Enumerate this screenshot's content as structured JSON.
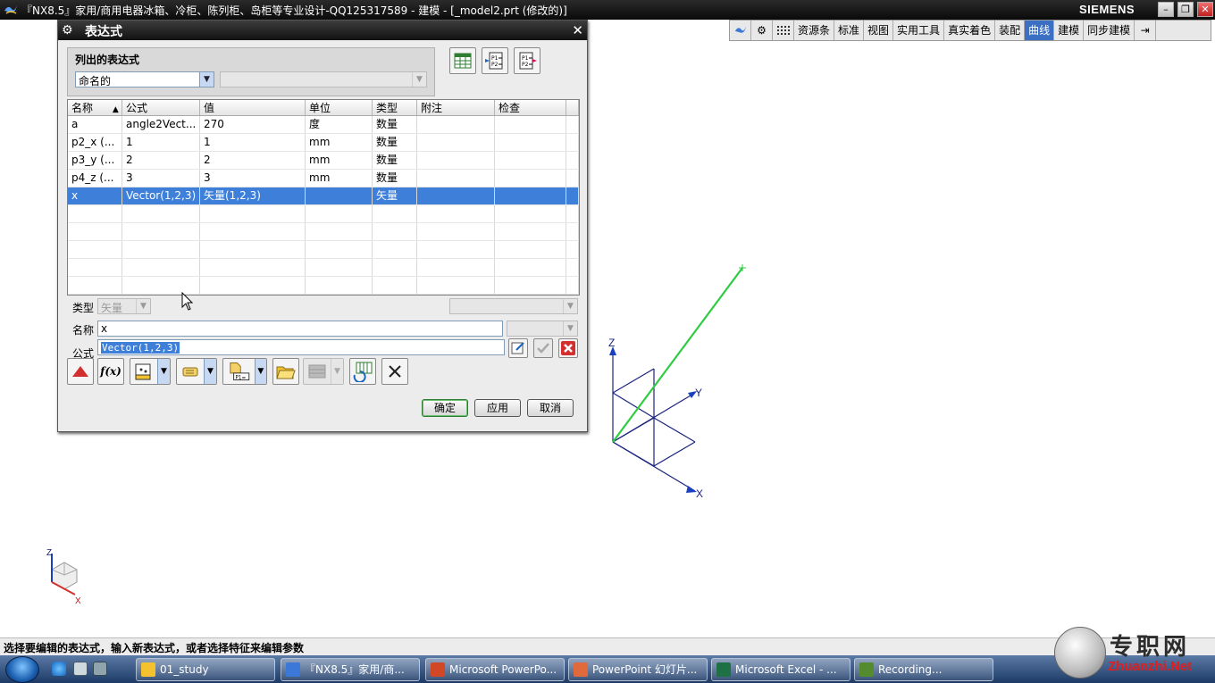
{
  "window": {
    "title": "『NX8.5』家用/商用电器冰箱、冷柜、陈列柜、岛柜等专业设计-QQ125317589 - 建模 - [_model2.prt (修改的)]",
    "brand": "SIEMENS"
  },
  "toolbar": {
    "items": [
      "资源条",
      "标准",
      "视图",
      "实用工具",
      "真实着色",
      "装配",
      "曲线",
      "建模",
      "同步建模"
    ],
    "active": "曲线"
  },
  "dialog": {
    "title": "表达式",
    "listed_group": {
      "label": "列出的表达式",
      "filter_value": "命名的"
    },
    "table": {
      "headers": [
        "名称",
        "公式",
        "值",
        "单位",
        "类型",
        "附注",
        "检查"
      ],
      "rows": [
        [
          "a",
          "angle2Vect...",
          "270",
          "度",
          "数量",
          "",
          ""
        ],
        [
          "p2_x (...",
          "1",
          "1",
          "mm",
          "数量",
          "",
          ""
        ],
        [
          "p3_y (...",
          "2",
          "2",
          "mm",
          "数量",
          "",
          ""
        ],
        [
          "p4_z (...",
          "3",
          "3",
          "mm",
          "数量",
          "",
          ""
        ],
        [
          "x",
          "Vector(1,2,3)",
          "矢量(1,2,3)",
          "",
          "矢量",
          "",
          ""
        ]
      ],
      "selected_row": 4
    },
    "type_label": "类型",
    "type_value": "矢量",
    "name_label": "名称",
    "name_value": "x",
    "formula_label": "公式",
    "formula_value": "Vector(1,2,3)",
    "buttons": {
      "ok": "确定",
      "apply": "应用",
      "cancel": "取消"
    }
  },
  "viewport": {
    "axis_labels": {
      "z": "Z",
      "y": "Y",
      "x": "X"
    },
    "vector_color": "#2ecc40",
    "triad_labels": {
      "z": "Z",
      "x": "X"
    }
  },
  "status": {
    "text": "选择要编辑的表达式，输入新表达式，或者选择特征来编辑参数"
  },
  "taskbar": {
    "tasks": [
      "01_study",
      "『NX8.5』家用/商...",
      "Microsoft PowerPo...",
      "PowerPoint 幻灯片...",
      "Microsoft Excel - ...",
      "Recording..."
    ]
  },
  "watermark": {
    "cn": "专职网",
    "en": "Zhuanzhi.Net"
  }
}
